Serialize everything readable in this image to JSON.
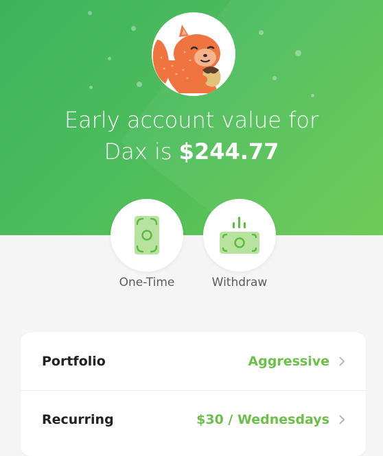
{
  "header": {
    "headline_line1": "Early account value for",
    "headline_line2_prefix": "Dax is",
    "account_value": "$244.77",
    "avatar_icon": "squirrel-icon"
  },
  "actions": [
    {
      "label": "One-Time",
      "icon": "money-bill-icon"
    },
    {
      "label": "Withdraw",
      "icon": "withdraw-money-icon"
    }
  ],
  "settings": {
    "rows": [
      {
        "title": "Portfolio",
        "value": "Aggressive"
      },
      {
        "title": "Recurring",
        "value": "$30 / Wednesdays"
      }
    ]
  },
  "colors": {
    "brand_green": "#4cbc5d",
    "accent_green": "#6cc04a",
    "squirrel_orange": "#ef7440"
  }
}
